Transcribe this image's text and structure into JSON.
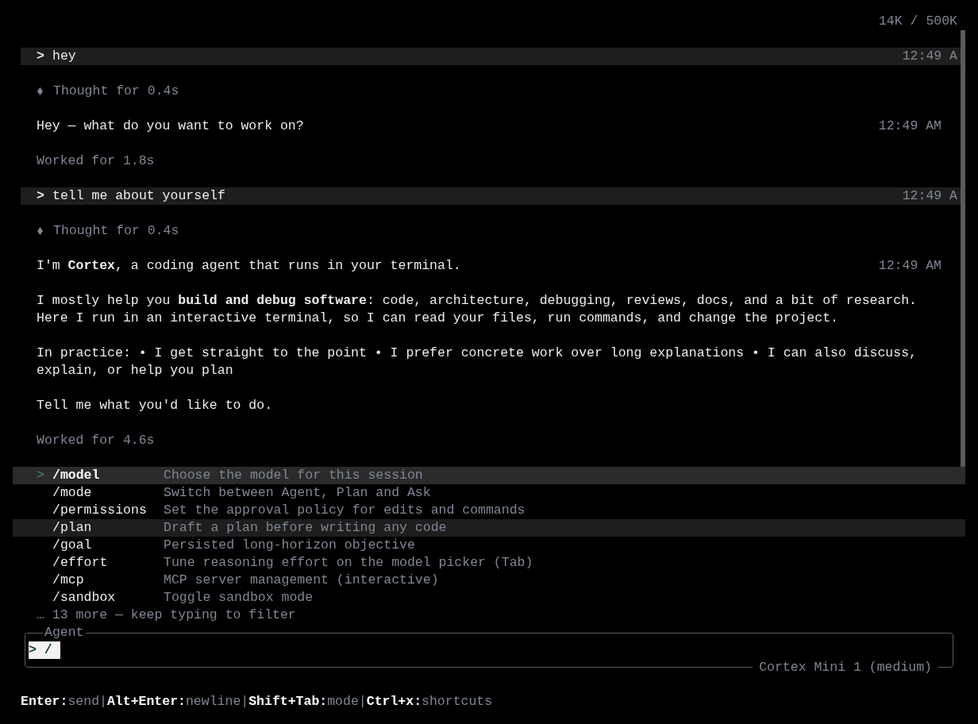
{
  "token_usage": "14K / 500K",
  "messages": [
    {
      "kind": "user",
      "prompt": ">",
      "text": "hey",
      "time": "12:49 A"
    },
    {
      "kind": "thought",
      "text": "Thought for 0.4s"
    },
    {
      "kind": "assistant",
      "paragraphs": [
        "Hey — what do you want to work on?"
      ],
      "time": "12:49 AM"
    },
    {
      "kind": "worked",
      "text": "Worked for 1.8s"
    },
    {
      "kind": "user",
      "prompt": ">",
      "text": "tell me about yourself",
      "time": "12:49 A"
    },
    {
      "kind": "thought",
      "text": "Thought for 0.4s"
    },
    {
      "kind": "assistant",
      "paragraphs": [
        "I'm **Cortex**, a coding agent that runs in your terminal.",
        "I mostly help you **build and debug software**: code, architecture, debugging, reviews, docs, and a bit of research. Here I run in an interactive terminal, so I can read your files, run commands, and change the project.",
        "In practice: • I get straight to the point • I prefer concrete work over long explanations • I can also discuss, explain, or help you plan",
        "Tell me what you'd like to do."
      ],
      "time": "12:49 AM"
    },
    {
      "kind": "worked",
      "text": "Worked for 4.6s"
    }
  ],
  "command_menu": {
    "marker": ">",
    "items": [
      {
        "command": "/model",
        "description": "Choose the model for this session",
        "selected": true,
        "hovered": false
      },
      {
        "command": "/mode",
        "description": "Switch between Agent, Plan and Ask",
        "selected": false,
        "hovered": false
      },
      {
        "command": "/permissions",
        "description": "Set the approval policy for edits and commands",
        "selected": false,
        "hovered": false
      },
      {
        "command": "/plan",
        "description": "Draft a plan before writing any code",
        "selected": false,
        "hovered": true
      },
      {
        "command": "/goal",
        "description": "Persisted long-horizon objective",
        "selected": false,
        "hovered": false
      },
      {
        "command": "/effort",
        "description": "Tune reasoning effort on the model picker (Tab)",
        "selected": false,
        "hovered": false
      },
      {
        "command": "/mcp",
        "description": "MCP server management (interactive)",
        "selected": false,
        "hovered": false
      },
      {
        "command": "/sandbox",
        "description": "Toggle sandbox mode",
        "selected": false,
        "hovered": false
      }
    ],
    "more": "… 13 more — keep typing to filter"
  },
  "input": {
    "mode": "Agent",
    "prompt": ">",
    "value": "/",
    "model": "Cortex Mini 1 (medium)"
  },
  "shortcuts": [
    {
      "key": "Enter:",
      "action": "send",
      "separator": "|"
    },
    {
      "key": "Alt+Enter:",
      "action": "newline",
      "separator": "|"
    },
    {
      "key": "Shift+Tab:",
      "action": "mode",
      "separator": "|"
    },
    {
      "key": "Ctrl+x:",
      "action": "shortcuts"
    }
  ]
}
